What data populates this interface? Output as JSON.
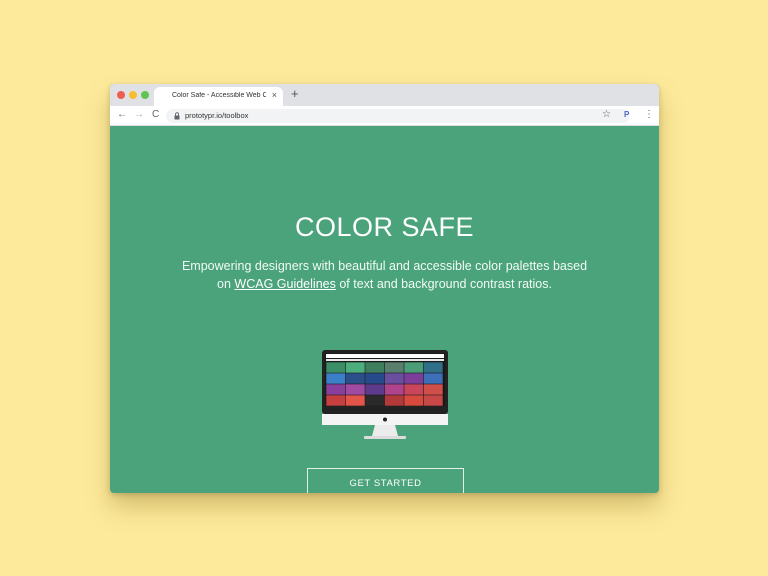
{
  "browser": {
    "tab_title": "Color Safe - Accessible Web Colo",
    "tab_close": "×",
    "new_tab": "+",
    "url": "prototypr.io/toolbox",
    "nav_back": "←",
    "nav_forward": "→",
    "nav_reload": "C",
    "bookmark_star": "☆",
    "extension_label": "P",
    "menu": "⋮"
  },
  "hero": {
    "title": "COLOR SAFE",
    "tagline_prefix": "Empowering designers with beautiful and accessible color palettes based on",
    "link_text": "WCAG Guidelines",
    "tagline_suffix": " of text and background contrast ratios.",
    "cta_label": "GET STARTED"
  },
  "illustration": {
    "name": "monitor-illustration",
    "swatches": [
      "#3b8f66",
      "#4cae7d",
      "#3d7f5f",
      "#5a7f6e",
      "#4a9d76",
      "#2f6f88",
      "#3a7fc8",
      "#2b4f88",
      "#274a8a",
      "#6a4fa0",
      "#7b3f9a",
      "#3c6fb8",
      "#8a3f9c",
      "#a04aa2",
      "#5e3b8a",
      "#b0448c",
      "#c8455a",
      "#d04f48",
      "#c83f3f",
      "#e25548",
      "#2a2a2a",
      "#b23a3a",
      "#d84a3e",
      "#c84848"
    ]
  },
  "colors": {
    "page_background": "#fdea9b",
    "hero_background": "#4aa37a",
    "hero_text": "#ffffff"
  }
}
